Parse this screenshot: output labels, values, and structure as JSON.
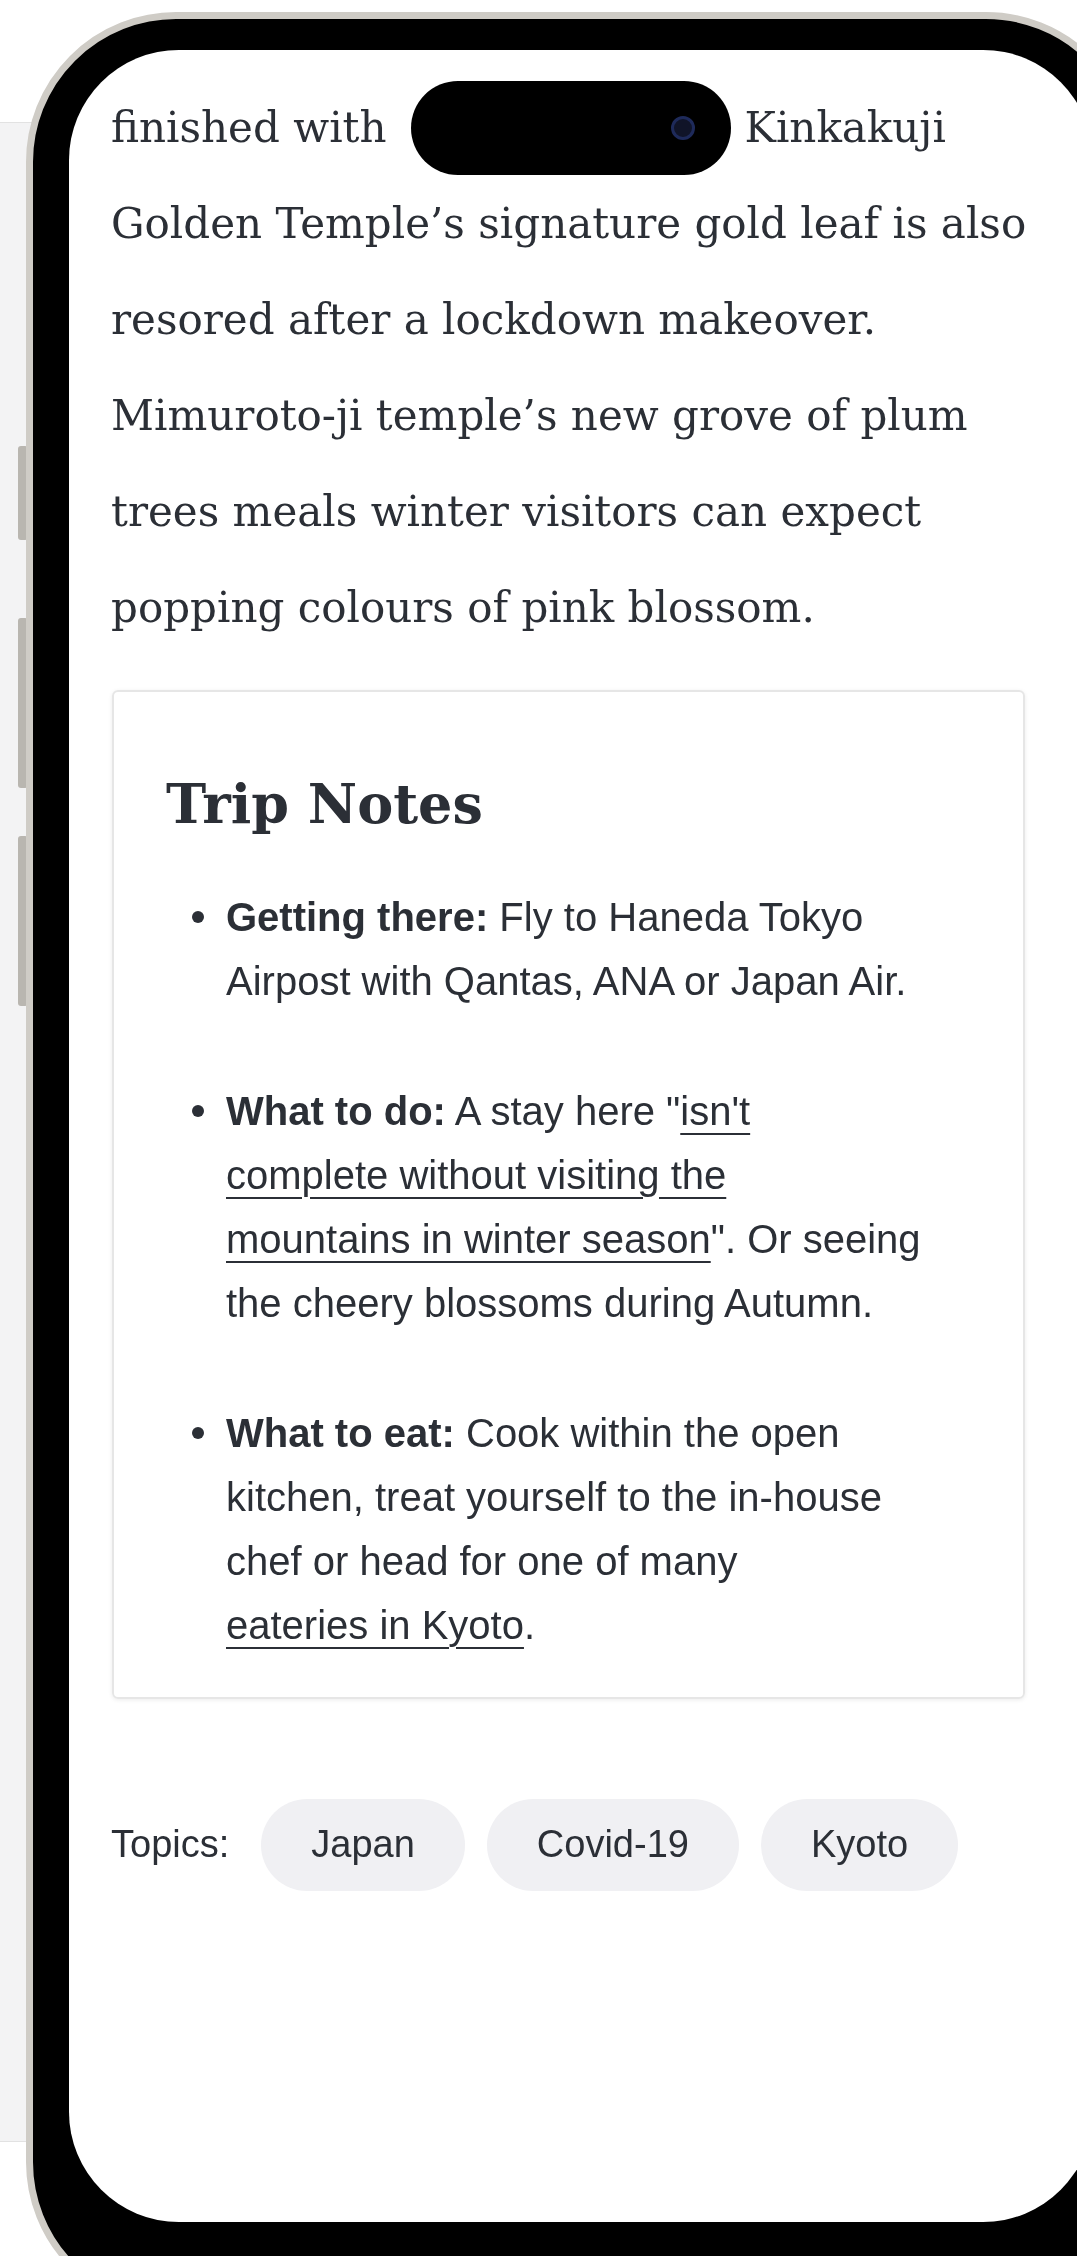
{
  "article": {
    "first_line_start": "finished with",
    "first_line_end": "Kinkakuji",
    "paragraph": "Golden Temple’s signature gold leaf is also resored after a lockdown makeover. Mimuroto-ji temple’s new grove of plum trees meals winter visitors can expect popping colours of pink blossom."
  },
  "trip_notes": {
    "title": "Trip Notes",
    "items": [
      {
        "label": "Getting there:",
        "segments": [
          {
            "kind": "text",
            "text": " Fly to Haneda Tokyo Airpost with Qantas, ANA or Japan Air."
          }
        ]
      },
      {
        "label": "What to do:",
        "segments": [
          {
            "kind": "text",
            "text": " A stay here \""
          },
          {
            "kind": "link",
            "text": "isn't"
          },
          {
            "kind": "link",
            "text": "complete without visiting the"
          },
          {
            "kind": "link",
            "text": "mountains in winter season"
          },
          {
            "kind": "text",
            "text": "\". Or seeing the cheery blossoms during Autumn."
          }
        ]
      },
      {
        "label": "What to eat:",
        "segments": [
          {
            "kind": "text",
            "text": " Cook within the open kitchen, treat yourself to the in-house chef or head for one of many "
          },
          {
            "kind": "link",
            "text": "eateries in Kyoto"
          },
          {
            "kind": "text",
            "text": "."
          }
        ]
      }
    ]
  },
  "topics": {
    "label": "Topics:",
    "tags": [
      "Japan",
      "Covid-19",
      "Kyoto"
    ]
  }
}
